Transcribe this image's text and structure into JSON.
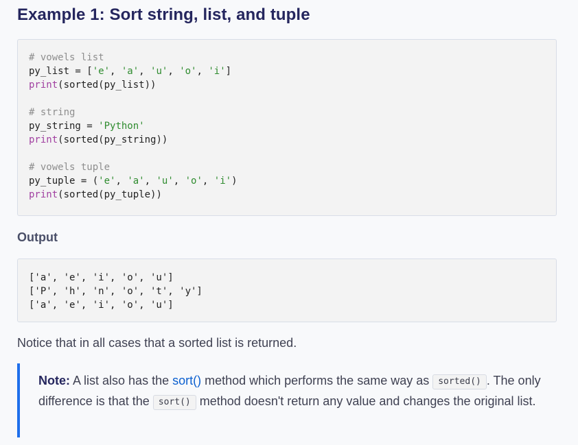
{
  "heading": "Example 1: Sort string, list, and tuple",
  "code_block": {
    "lines": [
      {
        "parts": [
          {
            "t": "# vowels list",
            "c": "cm"
          }
        ]
      },
      {
        "parts": [
          {
            "t": "py_list = [",
            "c": "pl"
          },
          {
            "t": "'e'",
            "c": "st"
          },
          {
            "t": ", ",
            "c": "pl"
          },
          {
            "t": "'a'",
            "c": "st"
          },
          {
            "t": ", ",
            "c": "pl"
          },
          {
            "t": "'u'",
            "c": "st"
          },
          {
            "t": ", ",
            "c": "pl"
          },
          {
            "t": "'o'",
            "c": "st"
          },
          {
            "t": ", ",
            "c": "pl"
          },
          {
            "t": "'i'",
            "c": "st"
          },
          {
            "t": "]",
            "c": "pl"
          }
        ]
      },
      {
        "parts": [
          {
            "t": "print",
            "c": "fn"
          },
          {
            "t": "(sorted(py_list))",
            "c": "pl"
          }
        ]
      },
      {
        "parts": []
      },
      {
        "parts": [
          {
            "t": "# string",
            "c": "cm"
          }
        ]
      },
      {
        "parts": [
          {
            "t": "py_string = ",
            "c": "pl"
          },
          {
            "t": "'Python'",
            "c": "st"
          }
        ]
      },
      {
        "parts": [
          {
            "t": "print",
            "c": "fn"
          },
          {
            "t": "(sorted(py_string))",
            "c": "pl"
          }
        ]
      },
      {
        "parts": []
      },
      {
        "parts": [
          {
            "t": "# vowels tuple",
            "c": "cm"
          }
        ]
      },
      {
        "parts": [
          {
            "t": "py_tuple = (",
            "c": "pl"
          },
          {
            "t": "'e'",
            "c": "st"
          },
          {
            "t": ", ",
            "c": "pl"
          },
          {
            "t": "'a'",
            "c": "st"
          },
          {
            "t": ", ",
            "c": "pl"
          },
          {
            "t": "'u'",
            "c": "st"
          },
          {
            "t": ", ",
            "c": "pl"
          },
          {
            "t": "'o'",
            "c": "st"
          },
          {
            "t": ", ",
            "c": "pl"
          },
          {
            "t": "'i'",
            "c": "st"
          },
          {
            "t": ")",
            "c": "pl"
          }
        ]
      },
      {
        "parts": [
          {
            "t": "print",
            "c": "fn"
          },
          {
            "t": "(sorted(py_tuple))",
            "c": "pl"
          }
        ]
      }
    ]
  },
  "output_heading": "Output",
  "output_block": {
    "lines": [
      "['a', 'e', 'i', 'o', 'u']",
      "['P', 'h', 'n', 'o', 't', 'y']",
      "['a', 'e', 'i', 'o', 'u']"
    ]
  },
  "notice_text": "Notice that in all cases that a sorted list is returned.",
  "note": {
    "label": "Note:",
    "text_before_link": " A list also has the ",
    "link_text": "sort()",
    "text_after_link": " method which performs the same way as ",
    "code_1": "sorted()",
    "text_middle": ". The only difference is that the ",
    "code_2": "sort()",
    "text_end": " method doesn't return any value and changes the original list."
  },
  "colors": {
    "comment": "#8e8e8e",
    "string": "#2e8b2e",
    "builtin": "#a03fa0",
    "link": "#0b5fcf",
    "note_border": "#1f6feb"
  }
}
